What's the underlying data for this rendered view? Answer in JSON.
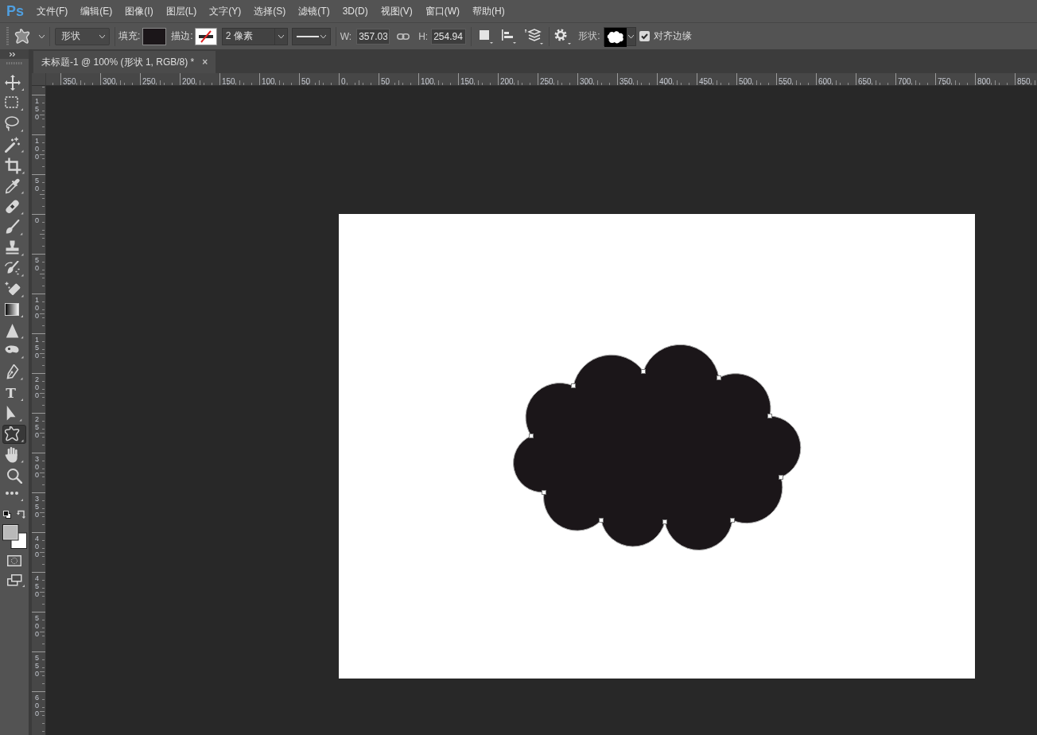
{
  "app": {
    "logo": "Ps"
  },
  "menu": [
    "文件(F)",
    "编辑(E)",
    "图像(I)",
    "图层(L)",
    "文字(Y)",
    "选择(S)",
    "滤镜(T)",
    "3D(D)",
    "视图(V)",
    "窗口(W)",
    "帮助(H)"
  ],
  "options_bar": {
    "mode": "形状",
    "fill_label": "填充:",
    "stroke_label": "描边:",
    "stroke_width": "2 像素",
    "width_label": "W:",
    "width_value": "357.03",
    "height_label": "H:",
    "height_value": "254.94",
    "shape_label": "形状:",
    "align_edges": {
      "label": "对齐边缘",
      "checked": true
    }
  },
  "toolbar": {
    "tools": [
      {
        "kind": "move",
        "selected": false
      },
      {
        "kind": "marquee",
        "selected": false
      },
      {
        "kind": "lasso",
        "selected": false
      },
      {
        "kind": "wand",
        "selected": false
      },
      {
        "kind": "crop",
        "selected": false
      },
      {
        "kind": "eyedropper",
        "selected": false
      },
      {
        "kind": "healing",
        "selected": false
      },
      {
        "kind": "brush",
        "selected": false
      },
      {
        "kind": "stamp",
        "selected": false
      },
      {
        "kind": "history",
        "selected": false
      },
      {
        "kind": "eraser",
        "selected": false
      },
      {
        "kind": "gradient",
        "selected": false
      },
      {
        "kind": "blur",
        "selected": false
      },
      {
        "kind": "dodge",
        "selected": false
      },
      {
        "kind": "pen",
        "selected": false
      },
      {
        "kind": "type",
        "selected": false,
        "glyph": "T"
      },
      {
        "kind": "select",
        "selected": false
      },
      {
        "kind": "shape",
        "selected": true
      },
      {
        "kind": "hand",
        "selected": false
      },
      {
        "kind": "zoom",
        "selected": false
      },
      {
        "kind": "more",
        "selected": false
      }
    ]
  },
  "document": {
    "tab_title": "未标题-1 @ 100% (形状 1, RGB/8) *",
    "close": "×"
  },
  "rulers": {
    "horizontal": [
      "350",
      "300",
      "250",
      "200",
      "150",
      "100",
      "50",
      "0",
      "50",
      "100",
      "150",
      "200",
      "250",
      "300",
      "350",
      "400",
      "450",
      "500",
      "550",
      "600",
      "650",
      "700",
      "750",
      "800",
      "850"
    ],
    "vertical": [
      "150",
      "100",
      "50",
      "0",
      "50",
      "100",
      "150",
      "200",
      "250",
      "300",
      "350",
      "400",
      "450",
      "500",
      "550",
      "600"
    ]
  }
}
